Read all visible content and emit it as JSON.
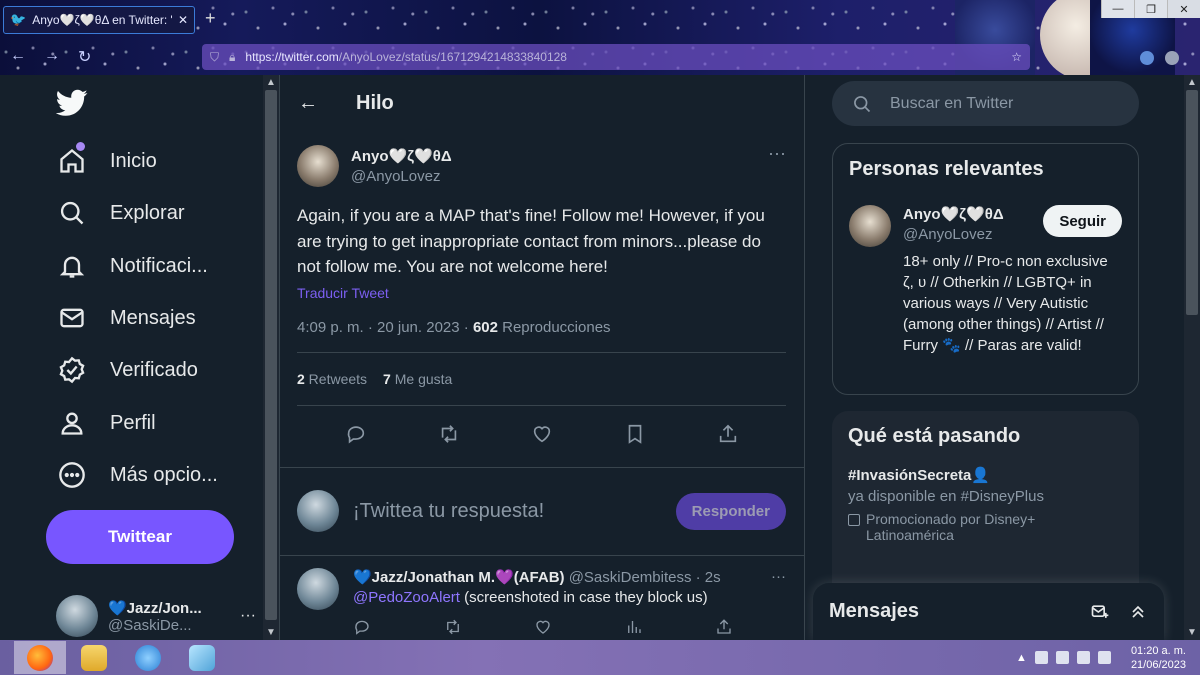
{
  "browser": {
    "tab_title": "Anyo🤍ζ🤍θΔ en Twitter: \"Again",
    "tab_close": "✕",
    "new_tab": "+",
    "url_domain": "https://twitter.com",
    "url_path": "/AnyoLovez/status/1671294214833840128"
  },
  "sidebar": {
    "items": [
      {
        "label": "Inicio",
        "icon": "home-icon"
      },
      {
        "label": "Explorar",
        "icon": "search-icon"
      },
      {
        "label": "Notificaci...",
        "icon": "bell-icon"
      },
      {
        "label": "Mensajes",
        "icon": "mail-icon"
      },
      {
        "label": "Verificado",
        "icon": "verified-icon"
      },
      {
        "label": "Perfil",
        "icon": "person-icon"
      },
      {
        "label": "Más opcio...",
        "icon": "more-circle-icon"
      }
    ],
    "tweet_button": "Twittear",
    "account": {
      "name": "💙Jazz/Jon...",
      "handle": "@SaskiDe..."
    }
  },
  "main": {
    "header_title": "Hilo",
    "tweet": {
      "name": "Anyo🤍ζ🤍θΔ",
      "handle": "@AnyoLovez",
      "text": "Again, if you are a MAP that's fine! Follow me! However, if you are trying to get inappropriate contact from minors...please do not follow me. You are not welcome here!",
      "translate": "Traducir Tweet",
      "time": "4:09 p. m. · 20 jun. 2023 · ",
      "views": "602",
      "views_label": " Reproducciones",
      "retweets": "2",
      "retweets_label": " Retweets",
      "likes": "7",
      "likes_label": " Me gusta",
      "more": "···"
    },
    "reply_placeholder": "¡Twittea tu respuesta!",
    "reply_button": "Responder",
    "reply": {
      "name": "💙Jazz/Jonathan M.💜(AFAB)",
      "handle": " @SaskiDembitess · 2s",
      "mention": "@PedoZooAlert",
      "text": " (screenshoted in case they block us)",
      "more": "···"
    }
  },
  "right": {
    "search_placeholder": "Buscar en Twitter",
    "relevant_title": "Personas relevantes",
    "person": {
      "name": "Anyo🤍ζ🤍θΔ",
      "handle": "@AnyoLovez",
      "follow": "Seguir",
      "bio": "18+ only // Pro-c non exclusive ζ, υ // Otherkin // LGBTQ+ in various ways // Very Autistic (among other things) // Artist // Furry 🐾 // Paras are valid!"
    },
    "trending_title": "Qué está pasando",
    "trend": {
      "name": "#InvasiónSecreta👤",
      "sub": "ya disponible en #DisneyPlus",
      "promo": "Promocionado por Disney+ Latinoamérica"
    },
    "messages_title": "Mensajes"
  },
  "taskbar": {
    "time": "01:20 a. m.",
    "date": "21/06/2023"
  },
  "colors": {
    "accent": "#7856ff",
    "background": "#15202b",
    "link": "#7c5ff2"
  }
}
